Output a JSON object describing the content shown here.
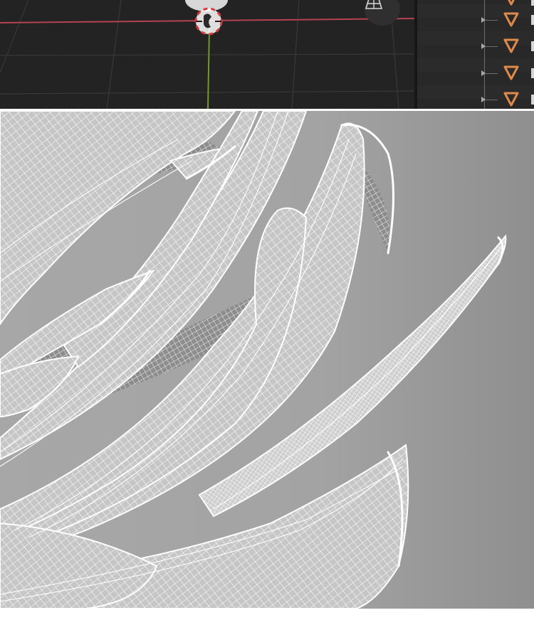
{
  "viewport": {
    "background_color": "#232323",
    "x_axis_color": "#b5424f",
    "y_axis_color": "#6f9a2d",
    "grid_color": "#3a3a3a",
    "cursor_color": "#d93a3a",
    "gizmo_icon": "perspective-grid-icon"
  },
  "outliner": {
    "background_color": "#282828",
    "rows": [
      {
        "icon": "mesh-triangle-icon",
        "icon_color": "#e0894a"
      },
      {
        "icon": "mesh-triangle-icon",
        "icon_color": "#e0894a"
      },
      {
        "icon": "mesh-triangle-icon",
        "icon_color": "#e0894a"
      },
      {
        "icon": "mesh-triangle-icon",
        "icon_color": "#e0894a"
      }
    ]
  },
  "render": {
    "background_color": "#a3a3a3",
    "wire_color": "#ffffff",
    "surface_color": "#c4c4c4"
  }
}
